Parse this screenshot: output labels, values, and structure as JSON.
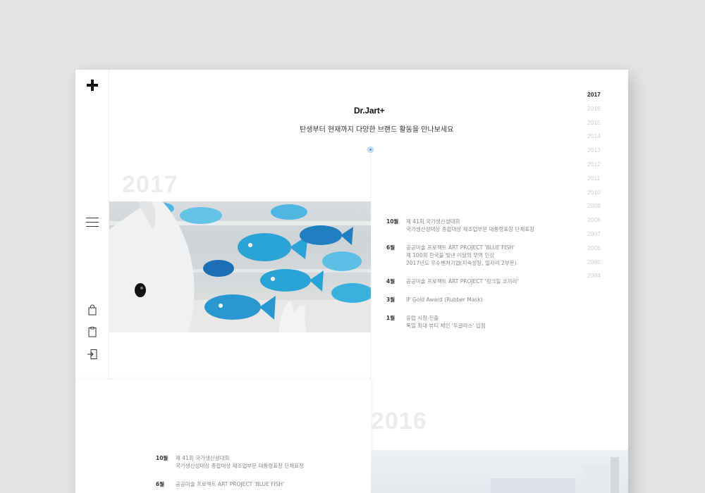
{
  "brand": {
    "name": "Dr.Jart+",
    "tagline": "탄생부터 현재까지 다양한 브랜드 활동을 만나보세요"
  },
  "sections": [
    {
      "year": "2017",
      "events": [
        {
          "month": "10월",
          "lines": [
            "제 41회 국가생산성대회",
            "국가생산성대상 종합대상 제조업부문 대통령표창 단체표창"
          ]
        },
        {
          "month": "6월",
          "lines": [
            "공공미술 프로젝트 ART PROJECT 'BLUE FISH'",
            "제 100회 한국을 빛낸 이달의 무역 인상",
            "2017년도 우수벤처기업(지속성장, 일자리 2부문)"
          ]
        },
        {
          "month": "4월",
          "lines": [
            "공공미술 프로젝트 ART PROJECT '핑크힐 코끼리'"
          ]
        },
        {
          "month": "3월",
          "lines": [
            "IF Gold Award (Rubber Mask)"
          ]
        },
        {
          "month": "1월",
          "lines": [
            "유럽 시장 진출",
            "독일 최대 뷰티 체인 '두글라스' 입점"
          ]
        }
      ]
    },
    {
      "year": "2016",
      "events": [
        {
          "month": "10월",
          "lines": [
            "제 41회 국가생산성대회",
            "국가생산성대상 종합대상 제조업부문 대통령표창 단체표창"
          ]
        },
        {
          "month": "6월",
          "lines": [
            "공공미술 프로젝트 ART PROJECT 'BLUE FISH'"
          ]
        }
      ]
    }
  ],
  "year_nav": {
    "active": "2017",
    "years": [
      "2017",
      "2016",
      "2015",
      "2014",
      "2013",
      "2012",
      "2011",
      "2010",
      "2009",
      "2008",
      "2007",
      "2006",
      "2005",
      "2004"
    ]
  },
  "icons": {
    "logo": "plus-logo-icon",
    "menu": "hamburger-menu-icon",
    "bag": "shopping-bag-icon",
    "clipboard": "clipboard-icon",
    "login": "login-door-icon"
  },
  "colors": {
    "accent": "#4c97cf",
    "active_year": "#222222",
    "inactive_year": "#cfcfcf",
    "big_year": "#ececec"
  }
}
